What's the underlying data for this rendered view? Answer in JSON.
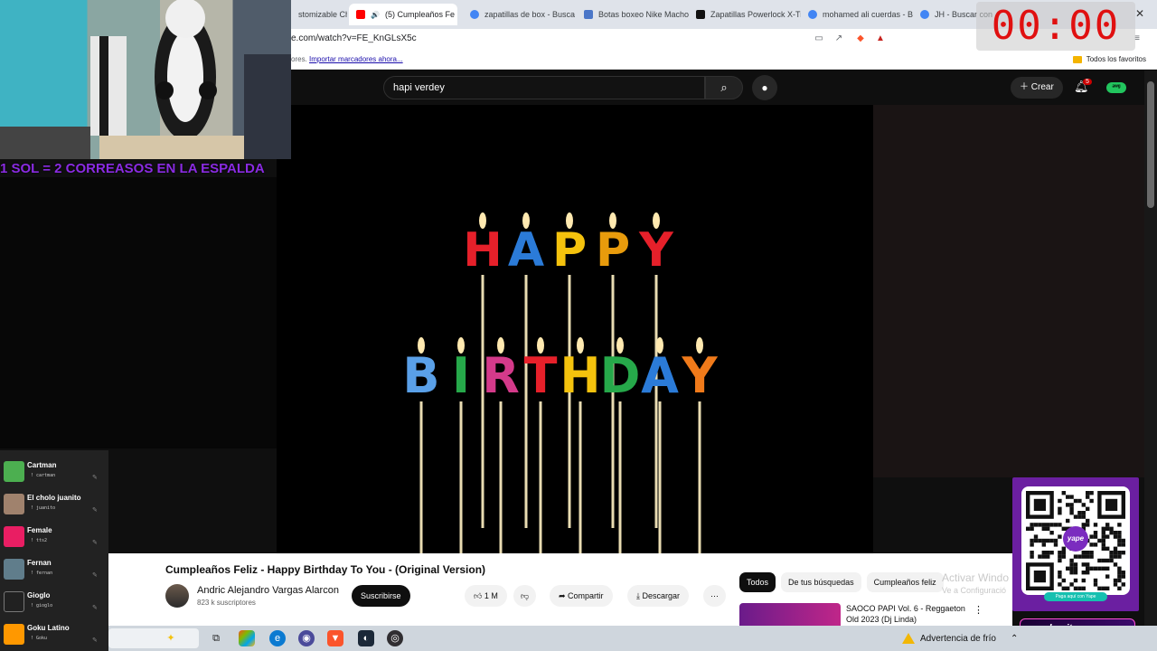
{
  "browser": {
    "tabs": [
      {
        "label": "stomizable Ch",
        "color": "#3c4043"
      },
      {
        "label": "(5) Cumpleaños Fe",
        "color": "#ff0000",
        "active": true
      },
      {
        "label": "zapatillas de box - Buscar",
        "color": "#4285f4"
      },
      {
        "label": "Botas boxeo Nike Machom",
        "color": "#4a76c8"
      },
      {
        "label": "Zapatillas Powerlock X-Tre",
        "color": "#111111"
      },
      {
        "label": "mohamed ali cuerdas - Bu",
        "color": "#4285f4"
      },
      {
        "label": "JH - Buscar con G",
        "color": "#4285f4"
      }
    ],
    "url": "e.com/watch?v=FE_KnGLsX5c",
    "bookmarks_text": "ores.",
    "bookmarks_link": "Importar marcadores ahora...",
    "all_bookmarks": "Todos los favoritos"
  },
  "youtube": {
    "search_value": "hapi verdey",
    "create_label": "Crear",
    "notifications": "5",
    "channel_badge": "ᵃʷᵍ",
    "video_title": "Cumpleaños Feliz - Happy Birthday To You - (Original Version)",
    "uploader": "Andric Alejandro Vargas Alarcon",
    "subscribers": "823 k suscriptores",
    "subscribe_label": "Suscribirse",
    "likes": "1 M",
    "share_label": "Compartir",
    "download_label": "Descargar",
    "chips": [
      "Todos",
      "De tus búsquedas",
      "Cumpleaños feliz"
    ],
    "recommended_title": "SAOCO PAPI Vol. 6 - Reggaeton Old 2023 (Dj Linda)",
    "video_words": {
      "line1": "HAPPY",
      "line2": "BIRTHDAY"
    }
  },
  "overlay": {
    "webcam_caption": "1 SOL = 2 CORREASOS EN LA ESPALDA",
    "timer": "00:00",
    "qr_caption": "Paga aquí con Yape",
    "qr_logo": "yape",
    "gamer_badge": "shavito-gamer",
    "viewers": [
      {
        "name": "Cartman",
        "handle": "! cartman",
        "color": "#4caf50"
      },
      {
        "name": "El cholo juanito",
        "handle": "! juanito",
        "color": "#a0826d"
      },
      {
        "name": "Female",
        "handle": "! tts2",
        "color": "#e91e63"
      },
      {
        "name": "Fernan",
        "handle": "! fernan",
        "color": "#607d8b"
      },
      {
        "name": "Gioglo",
        "handle": "! gioglo",
        "color": "#212121"
      },
      {
        "name": "Goku Latino",
        "handle": "! Goku",
        "color": "#ff9800"
      }
    ]
  },
  "windows": {
    "activate_title": "Activar Windo",
    "activate_sub": "Ve a Configuració",
    "weather": "Advertencia de frío"
  }
}
